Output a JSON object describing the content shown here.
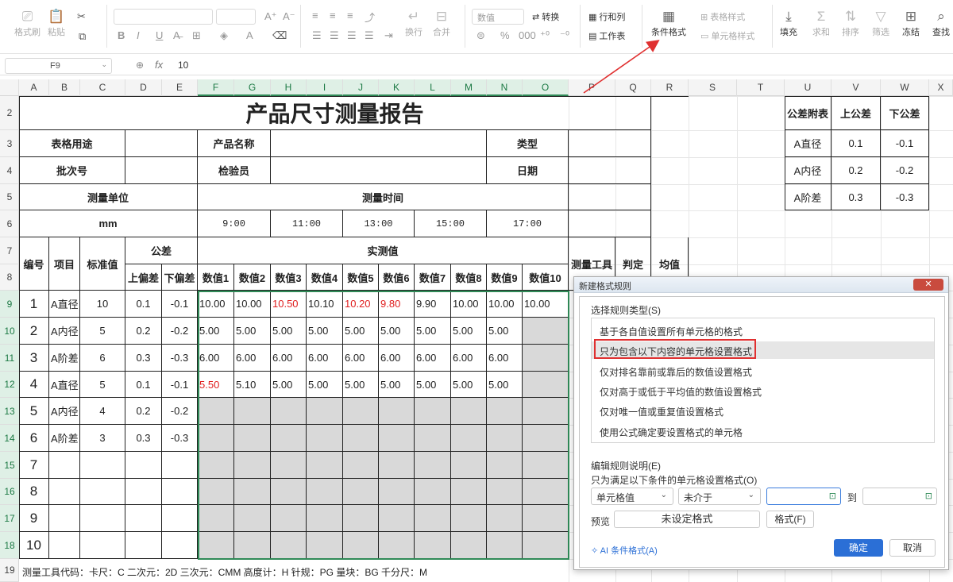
{
  "ribbon": {
    "format_painter": "格式刷",
    "paste": "粘贴",
    "fill_label": "填充",
    "sum_label": "求和",
    "sort_label": "排序",
    "filter_label": "筛选",
    "freeze_label": "冻结",
    "find_label": "查找",
    "number_format": "数值",
    "convert": "转换",
    "rows_cols": "行和列",
    "worksheet": "工作表",
    "cond_format": "条件格式",
    "table_style": "表格样式",
    "cell_style": "单元格样式",
    "wrap": "换行",
    "merge": "合并"
  },
  "formula_bar": {
    "cell_ref": "F9",
    "fx": "fx",
    "value": "10"
  },
  "columns": [
    "A",
    "B",
    "C",
    "D",
    "E",
    "F",
    "G",
    "H",
    "I",
    "J",
    "K",
    "L",
    "M",
    "N",
    "O",
    "P",
    "Q",
    "R",
    "S",
    "T",
    "U",
    "V",
    "W",
    "X"
  ],
  "rows": [
    "2",
    "3",
    "4",
    "5",
    "6",
    "7",
    "8",
    "9",
    "10",
    "11",
    "12",
    "13",
    "14",
    "15",
    "16",
    "17",
    "18",
    "19"
  ],
  "sheet": {
    "title": "产品尺寸测量报告",
    "table_use": "表格用途",
    "product_name": "产品名称",
    "type": "类型",
    "batch_no": "批次号",
    "inspector": "检验员",
    "date": "日期",
    "unit_label": "测量单位",
    "unit_value": "mm",
    "time_label": "测量时间",
    "times": [
      "9:00",
      "11:00",
      "13:00",
      "15:00",
      "17:00"
    ],
    "no_label": "编号",
    "item_label": "项目",
    "std_label": "标准值",
    "tol_label": "公差",
    "upper_label": "上偏差",
    "lower_label": "下偏差",
    "measured_label": "实测值",
    "value_headers": [
      "数值1",
      "数值2",
      "数值3",
      "数值4",
      "数值5",
      "数值6",
      "数值7",
      "数值8",
      "数值9",
      "数值10"
    ],
    "tool_label": "测量工具",
    "judge_label": "判定",
    "avg_label": "均值",
    "records": [
      {
        "no": "1",
        "item": "A直径",
        "std": "10",
        "up": "0.1",
        "low": "-0.1",
        "vals": [
          "10.00",
          "10.00",
          "10.50",
          "10.10",
          "10.20",
          "9.80",
          "9.90",
          "10.00",
          "10.00",
          "10.00"
        ],
        "red": [
          2,
          4,
          5
        ]
      },
      {
        "no": "2",
        "item": "A内径",
        "std": "5",
        "up": "0.2",
        "low": "-0.2",
        "vals": [
          "5.00",
          "5.00",
          "5.00",
          "5.00",
          "5.00",
          "5.00",
          "5.00",
          "5.00",
          "5.00",
          ""
        ],
        "red": []
      },
      {
        "no": "3",
        "item": "A阶差",
        "std": "6",
        "up": "0.3",
        "low": "-0.3",
        "vals": [
          "6.00",
          "6.00",
          "6.00",
          "6.00",
          "6.00",
          "6.00",
          "6.00",
          "6.00",
          "6.00",
          ""
        ],
        "red": []
      },
      {
        "no": "4",
        "item": "A直径",
        "std": "5",
        "up": "0.1",
        "low": "-0.1",
        "vals": [
          "5.50",
          "5.10",
          "5.00",
          "5.00",
          "5.00",
          "5.00",
          "5.00",
          "5.00",
          "5.00",
          ""
        ],
        "red": [
          0
        ]
      },
      {
        "no": "5",
        "item": "A内径",
        "std": "4",
        "up": "0.2",
        "low": "-0.2",
        "vals": [
          "",
          "",
          "",
          "",
          "",
          "",
          "",
          "",
          "",
          ""
        ],
        "red": []
      },
      {
        "no": "6",
        "item": "A阶差",
        "std": "3",
        "up": "0.3",
        "low": "-0.3",
        "vals": [
          "",
          "",
          "",
          "",
          "",
          "",
          "",
          "",
          "",
          ""
        ],
        "red": []
      },
      {
        "no": "7",
        "item": "",
        "std": "",
        "up": "",
        "low": "",
        "vals": [
          "",
          "",
          "",
          "",
          "",
          "",
          "",
          "",
          "",
          ""
        ],
        "red": []
      },
      {
        "no": "8",
        "item": "",
        "std": "",
        "up": "",
        "low": "",
        "vals": [
          "",
          "",
          "",
          "",
          "",
          "",
          "",
          "",
          "",
          ""
        ],
        "red": []
      },
      {
        "no": "9",
        "item": "",
        "std": "",
        "up": "",
        "low": "",
        "vals": [
          "",
          "",
          "",
          "",
          "",
          "",
          "",
          "",
          "",
          ""
        ],
        "red": []
      },
      {
        "no": "10",
        "item": "",
        "std": "",
        "up": "",
        "low": "",
        "vals": [
          "",
          "",
          "",
          "",
          "",
          "",
          "",
          "",
          "",
          ""
        ],
        "red": []
      }
    ],
    "footnote": "测量工具代码：卡尺：C 二次元：2D 三次元：CMM 高度计：H 针规：PG 量块：BG 千分尺：M"
  },
  "tolerance_table": {
    "headers": [
      "公差附表",
      "上公差",
      "下公差"
    ],
    "rows": [
      [
        "A直径",
        "0.1",
        "-0.1"
      ],
      [
        "A内径",
        "0.2",
        "-0.2"
      ],
      [
        "A阶差",
        "0.3",
        "-0.3"
      ]
    ]
  },
  "dialog": {
    "title": "新建格式规则",
    "select_type_label": "选择规则类型(S)",
    "rule_types": [
      "基于各自值设置所有单元格的格式",
      "只为包含以下内容的单元格设置格式",
      "仅对排名靠前或靠后的数值设置格式",
      "仅对高于或低于平均值的数值设置格式",
      "仅对唯一值或重复值设置格式",
      "使用公式确定要设置格式的单元格"
    ],
    "selected_index": 1,
    "edit_label": "编辑规则说明(E)",
    "condition_label": "只为满足以下条件的单元格设置格式(O)",
    "cond_field": "单元格值",
    "cond_op": "未介于",
    "to_label": "到",
    "preview_label": "预览",
    "preview_value": "未设定格式",
    "format_button": "格式(F)",
    "ai_label": "AI 条件格式(A)",
    "ok": "确定",
    "cancel": "取消"
  },
  "colors": {
    "accent": "#2f8a57",
    "red_value": "#e02020",
    "ok_button": "#2b6fd6",
    "highlight": "#e03030"
  }
}
